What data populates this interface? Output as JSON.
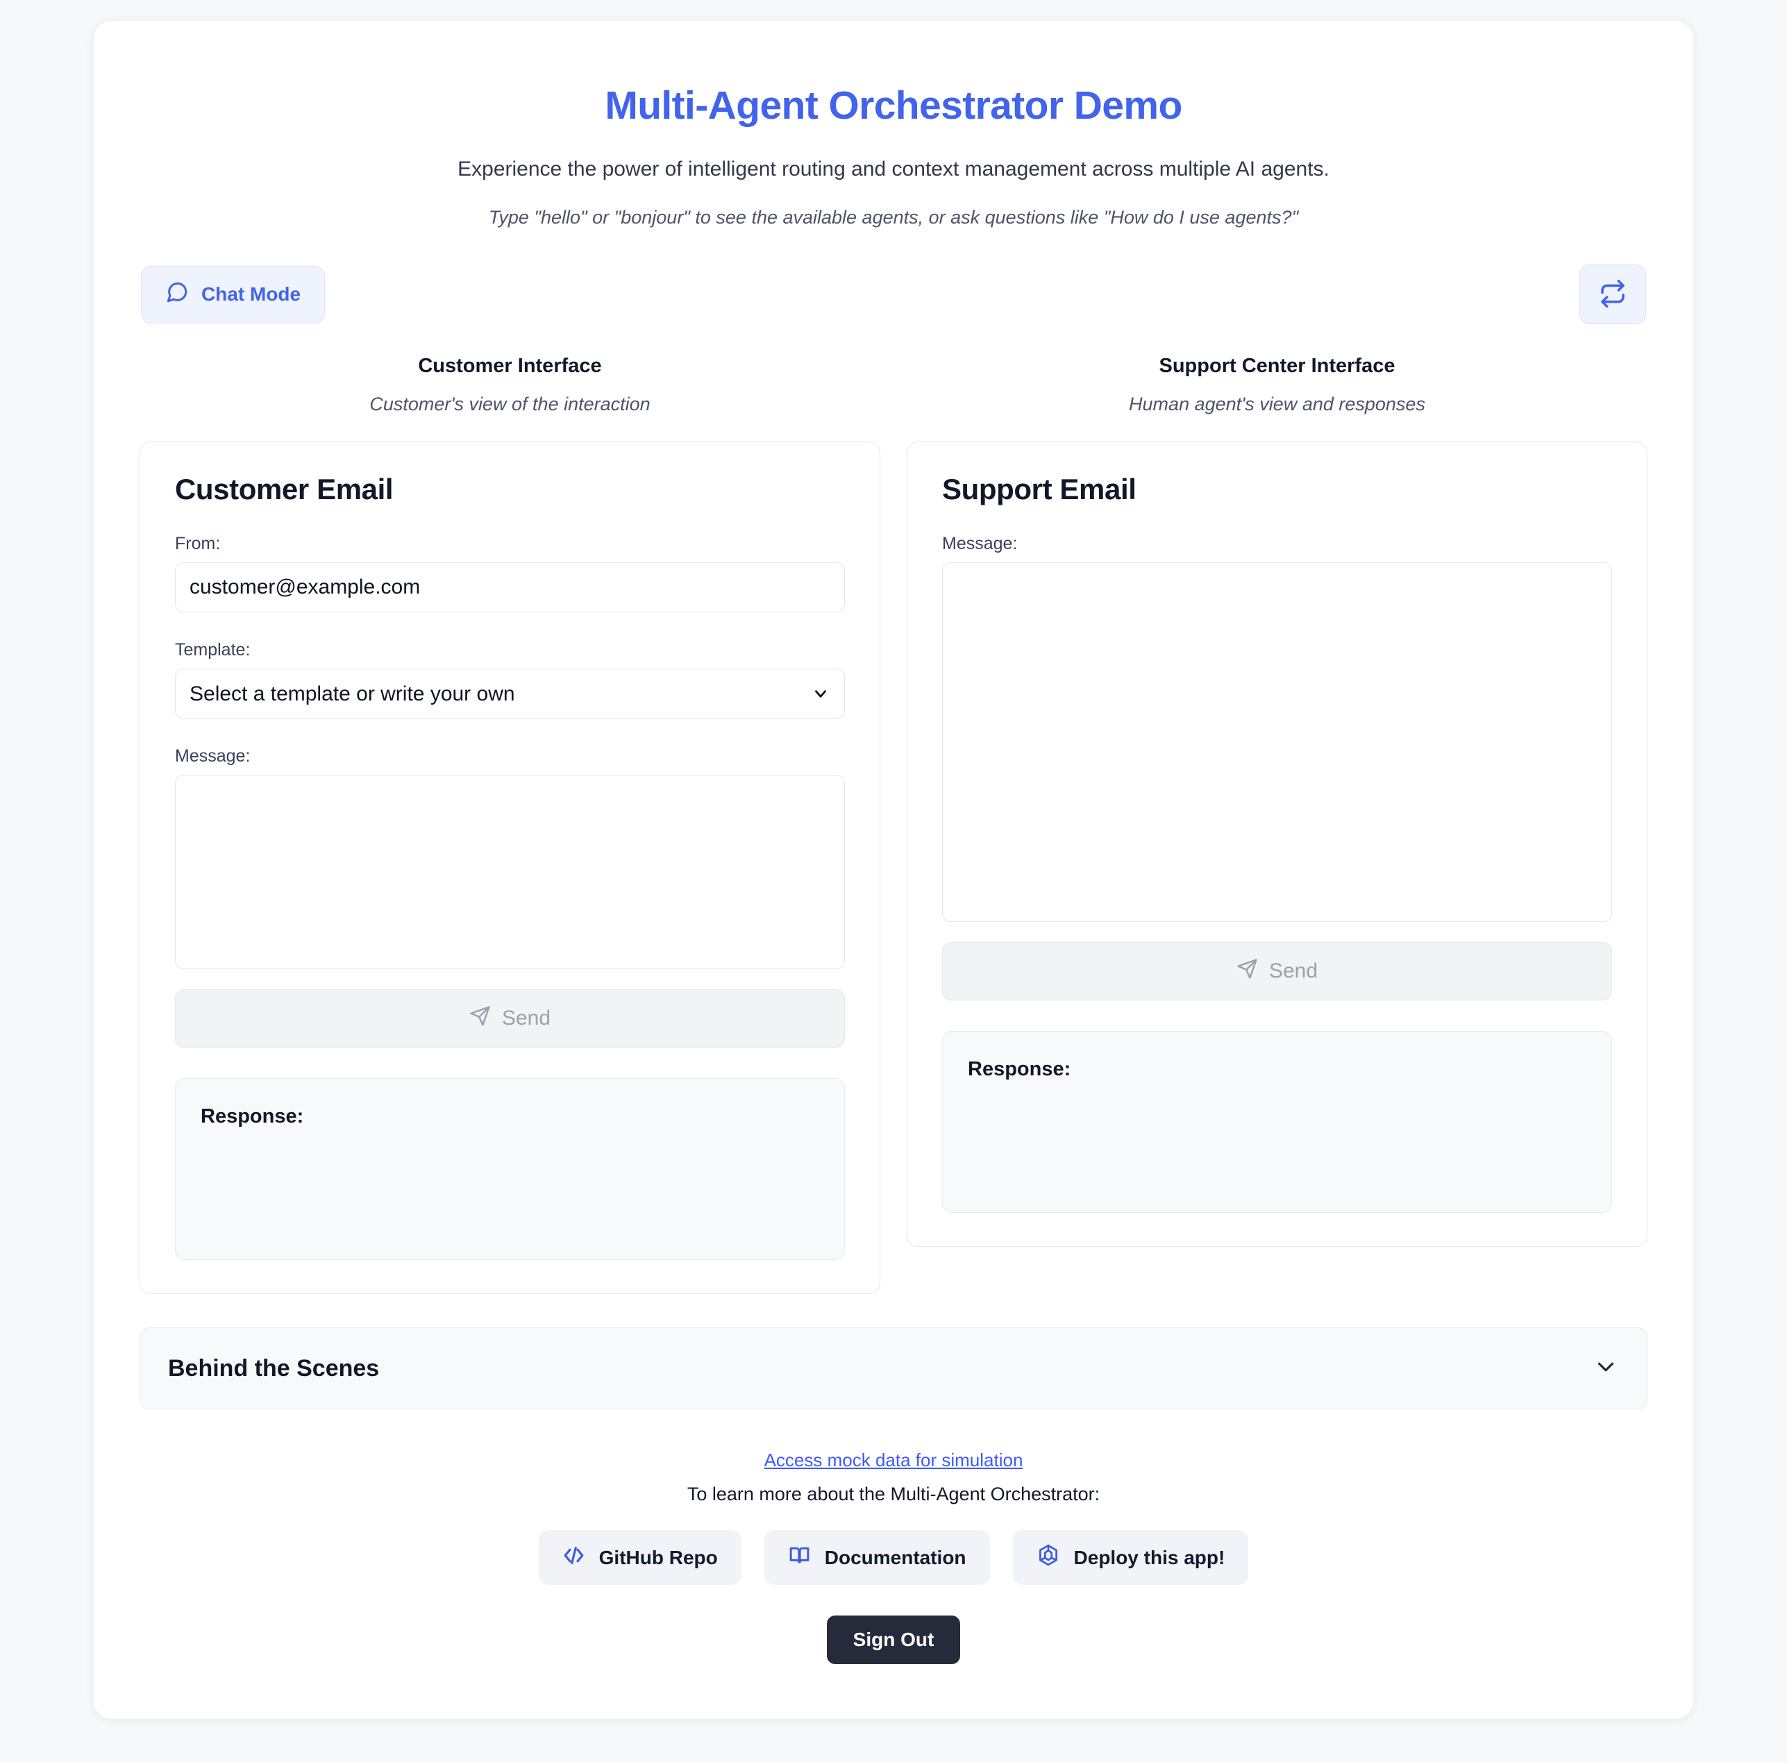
{
  "header": {
    "title": "Multi-Agent Orchestrator Demo",
    "subtitle": "Experience the power of intelligent routing and context management across multiple AI agents.",
    "hint": "Type \"hello\" or \"bonjour\" to see the available agents, or ask questions like \"How do I use agents?\"",
    "title_color": "#4263eb"
  },
  "mode_bar": {
    "chat_mode_label": "Chat Mode",
    "chat_mode_icon": "chat-bubble-icon",
    "refresh_icon": "refresh-icon",
    "accent_color": "#4263eb"
  },
  "panes": {
    "customer": {
      "heading": "Customer Interface",
      "subheading": "Customer's view of the interaction",
      "card_title": "Customer Email",
      "from_label": "From:",
      "from_value": "customer@example.com",
      "template_label": "Template:",
      "template_value": "Select a template or write your own",
      "template_options": [
        "Select a template or write your own"
      ],
      "message_label": "Message:",
      "message_value": "",
      "message_placeholder": "",
      "send_label": "Send",
      "send_icon": "paper-plane-icon",
      "response_label": "Response:",
      "response_value": ""
    },
    "support": {
      "heading": "Support Center Interface",
      "subheading": "Human agent's view and responses",
      "card_title": "Support Email",
      "message_label": "Message:",
      "message_value": "",
      "message_placeholder": "",
      "send_label": "Send",
      "send_icon": "paper-plane-icon",
      "response_label": "Response:",
      "response_value": ""
    }
  },
  "accordion": {
    "title": "Behind the Scenes",
    "chevron_icon": "chevron-down-icon",
    "expanded": false
  },
  "footer": {
    "mock_data_link": "Access mock data for simulation",
    "learn_more_text": "To learn more about the Multi-Agent Orchestrator:",
    "links": [
      {
        "label": "GitHub Repo",
        "icon": "code-brackets-icon"
      },
      {
        "label": "Documentation",
        "icon": "open-book-icon"
      },
      {
        "label": "Deploy this app!",
        "icon": "package-box-icon"
      }
    ],
    "sign_out_label": "Sign Out"
  }
}
